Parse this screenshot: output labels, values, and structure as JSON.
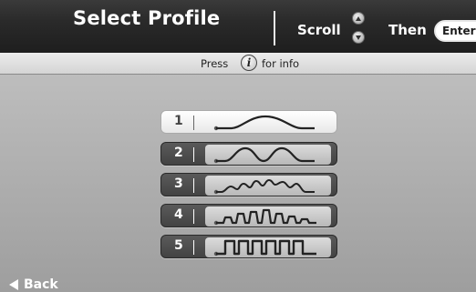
{
  "header": {
    "title": "Select Profile",
    "scroll_label": "Scroll",
    "then_label": "Then",
    "enter_label": "Enter"
  },
  "info_bar": {
    "press_text": "Press",
    "info_icon_glyph": "i",
    "info_text": "for info"
  },
  "profiles": [
    {
      "number": "1",
      "icon": "single-hill-wave-icon",
      "selected": true
    },
    {
      "number": "2",
      "icon": "double-hill-wave-icon",
      "selected": false
    },
    {
      "number": "3",
      "icon": "multi-hill-wave-icon",
      "selected": false
    },
    {
      "number": "4",
      "icon": "rolling-interval-wave-icon",
      "selected": false
    },
    {
      "number": "5",
      "icon": "square-interval-wave-icon",
      "selected": false
    }
  ],
  "footer": {
    "back_label": "Back",
    "back_icon": "back-arrow-icon"
  }
}
